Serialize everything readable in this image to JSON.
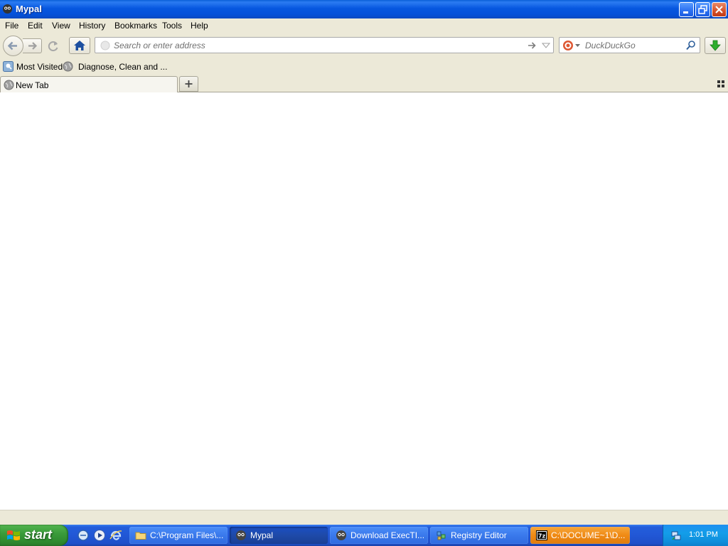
{
  "window": {
    "title": "Mypal"
  },
  "menu": {
    "items": [
      "File",
      "Edit",
      "View",
      "History",
      "Bookmarks",
      "Tools",
      "Help"
    ]
  },
  "navbar": {
    "url_placeholder": "Search or enter address",
    "search_placeholder": "DuckDuckGo"
  },
  "bookmarks": {
    "items": [
      "Most Visited",
      "Diagnose, Clean and ..."
    ]
  },
  "tabs": {
    "items": [
      {
        "label": "New Tab",
        "active": true
      }
    ]
  },
  "taskbar": {
    "start_label": "start",
    "quick_launch": [
      "ie-ish-icon",
      "media-player-icon",
      "internet-explorer-icon"
    ],
    "buttons": [
      {
        "label": "C:\\Program Files\\...",
        "icon": "folder-icon"
      },
      {
        "label": "Mypal",
        "icon": "mypal-icon"
      },
      {
        "label": "Download ExecTI...",
        "icon": "mypal-icon"
      },
      {
        "label": "Registry Editor",
        "icon": "registry-icon"
      },
      {
        "label": "C:\\DOCUME~1\\D...",
        "icon": "7zip-icon"
      }
    ],
    "clock": "1:01 PM"
  },
  "colors": {
    "titlebar": "#0757e0",
    "chrome": "#ece9d8",
    "taskbar": "#245edb",
    "start_green": "#3b9c3b",
    "tray": "#139ee9",
    "orange_task": "#f08a14"
  }
}
